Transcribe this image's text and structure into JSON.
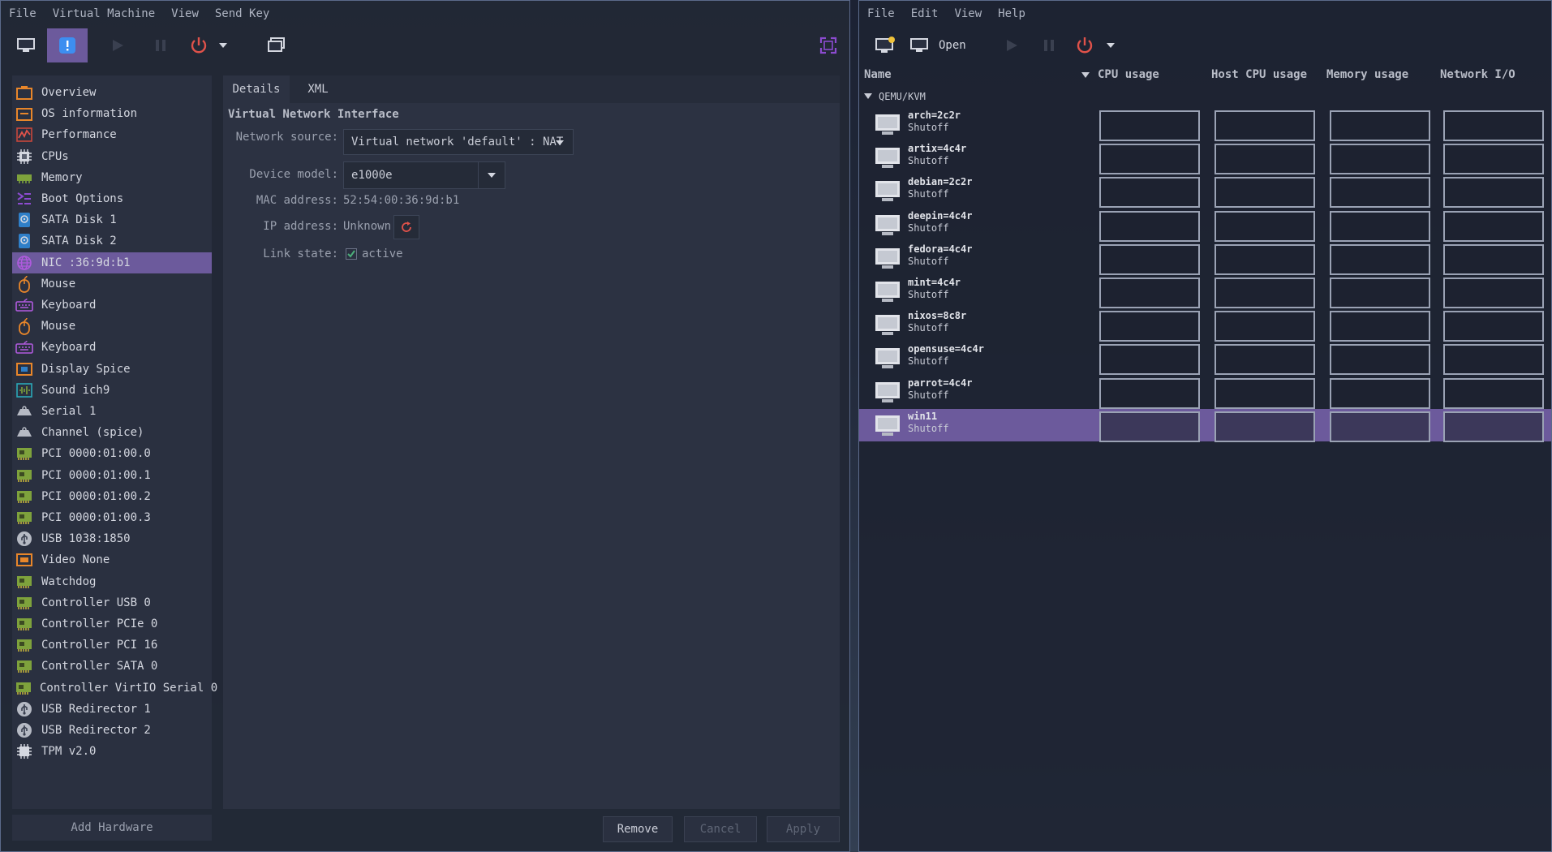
{
  "vm_window": {
    "menu": [
      "File",
      "Virtual Machine",
      "View",
      "Send Key"
    ],
    "sidebar_items": [
      {
        "label": "Overview",
        "icon": "overview-icon"
      },
      {
        "label": "OS information",
        "icon": "os-info-icon"
      },
      {
        "label": "Performance",
        "icon": "performance-icon"
      },
      {
        "label": "CPUs",
        "icon": "cpu-icon"
      },
      {
        "label": "Memory",
        "icon": "memory-icon"
      },
      {
        "label": "Boot Options",
        "icon": "boot-options-icon"
      },
      {
        "label": "SATA Disk 1",
        "icon": "disk-icon"
      },
      {
        "label": "SATA Disk 2",
        "icon": "disk-icon"
      },
      {
        "label": "NIC :36:9d:b1",
        "icon": "network-icon",
        "selected": true
      },
      {
        "label": "Mouse",
        "icon": "mouse-icon"
      },
      {
        "label": "Keyboard",
        "icon": "keyboard-icon"
      },
      {
        "label": "Mouse",
        "icon": "mouse-icon"
      },
      {
        "label": "Keyboard",
        "icon": "keyboard-icon"
      },
      {
        "label": "Display Spice",
        "icon": "display-icon"
      },
      {
        "label": "Sound ich9",
        "icon": "sound-icon"
      },
      {
        "label": "Serial 1",
        "icon": "serial-icon"
      },
      {
        "label": "Channel (spice)",
        "icon": "channel-icon"
      },
      {
        "label": "PCI 0000:01:00.0",
        "icon": "pci-card-icon"
      },
      {
        "label": "PCI 0000:01:00.1",
        "icon": "pci-card-icon"
      },
      {
        "label": "PCI 0000:01:00.2",
        "icon": "pci-card-icon"
      },
      {
        "label": "PCI 0000:01:00.3",
        "icon": "pci-card-icon"
      },
      {
        "label": "USB 1038:1850",
        "icon": "usb-icon"
      },
      {
        "label": "Video None",
        "icon": "video-icon"
      },
      {
        "label": "Watchdog",
        "icon": "pci-card-icon"
      },
      {
        "label": "Controller USB 0",
        "icon": "pci-card-icon"
      },
      {
        "label": "Controller PCIe 0",
        "icon": "pci-card-icon"
      },
      {
        "label": "Controller PCI 16",
        "icon": "pci-card-icon"
      },
      {
        "label": "Controller SATA 0",
        "icon": "pci-card-icon"
      },
      {
        "label": "Controller VirtIO Serial 0",
        "icon": "pci-card-icon"
      },
      {
        "label": "USB Redirector 1",
        "icon": "usb-icon"
      },
      {
        "label": "USB Redirector 2",
        "icon": "usb-icon"
      },
      {
        "label": "TPM v2.0",
        "icon": "chip-icon"
      }
    ],
    "add_hardware_label": "Add Hardware",
    "tabs": [
      "Details",
      "XML"
    ],
    "section_title": "Virtual Network Interface",
    "fields": {
      "network_source_label": "Network source:",
      "network_source_value": "Virtual network 'default' : NAT",
      "device_model_label": "Device model:",
      "device_model_value": "e1000e",
      "mac_label": "MAC address:",
      "mac_value": "52:54:00:36:9d:b1",
      "ip_label": "IP address:",
      "ip_value": "Unknown",
      "link_label": "Link state:",
      "link_value": "active",
      "link_checked": true
    },
    "buttons": {
      "remove": "Remove",
      "cancel": "Cancel",
      "apply": "Apply"
    }
  },
  "manager_window": {
    "menu": [
      "File",
      "Edit",
      "View",
      "Help"
    ],
    "open_label": "Open",
    "columns": [
      "Name",
      "CPU usage",
      "Host CPU usage",
      "Memory usage",
      "Network I/O"
    ],
    "group_label": "QEMU/KVM",
    "vms": [
      {
        "name": "arch=2c2r",
        "state": "Shutoff"
      },
      {
        "name": "artix=4c4r",
        "state": "Shutoff"
      },
      {
        "name": "debian=2c2r",
        "state": "Shutoff"
      },
      {
        "name": "deepin=4c4r",
        "state": "Shutoff"
      },
      {
        "name": "fedora=4c4r",
        "state": "Shutoff"
      },
      {
        "name": "mint=4c4r",
        "state": "Shutoff"
      },
      {
        "name": "nixos=8c8r",
        "state": "Shutoff"
      },
      {
        "name": "opensuse=4c4r",
        "state": "Shutoff"
      },
      {
        "name": "parrot=4c4r",
        "state": "Shutoff"
      },
      {
        "name": "win11",
        "state": "Shutoff",
        "selected": true
      }
    ]
  }
}
